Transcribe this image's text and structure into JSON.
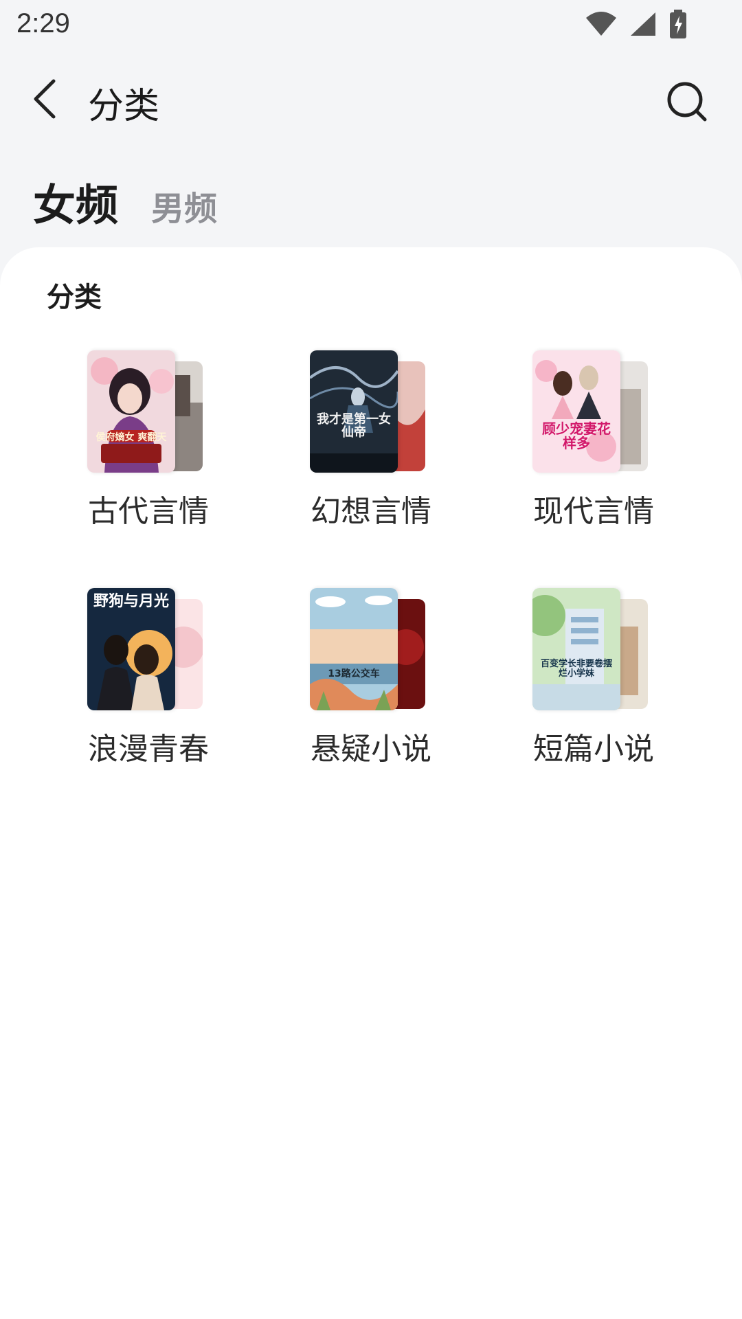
{
  "status_bar": {
    "time": "2:29"
  },
  "app_bar": {
    "title": "分类"
  },
  "tabs": [
    {
      "label": "女频",
      "selected": true
    },
    {
      "label": "男频",
      "selected": false
    }
  ],
  "section": {
    "title": "分类"
  },
  "categories": [
    {
      "label": "古代言情",
      "cover_title": "侯府嫡女 爽翻天"
    },
    {
      "label": "幻想言情",
      "cover_title": "我才是第一女仙帝"
    },
    {
      "label": "现代言情",
      "cover_title": "顾少宠妻花样多"
    },
    {
      "label": "浪漫青春",
      "cover_title": "野狗与月光"
    },
    {
      "label": "悬疑小说",
      "cover_title": "13路公交车"
    },
    {
      "label": "短篇小说",
      "cover_title": "百变学长非要卷摆烂小学妹"
    }
  ],
  "colors": {
    "page_background": "#f4f5f7",
    "card_background": "#ffffff",
    "tab_selected": "#1c1c1c",
    "tab_unselected": "#8e8f95"
  }
}
